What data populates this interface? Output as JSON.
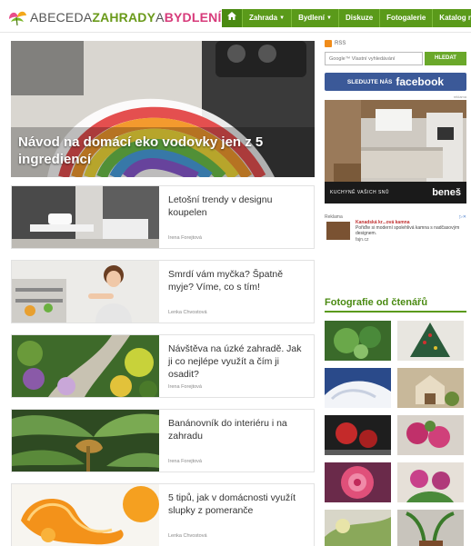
{
  "logo": {
    "part1": "ABECEDA",
    "part2": "ZAHRADY",
    "part3": "A",
    "part4": "BYDLENÍ"
  },
  "nav": {
    "items": [
      {
        "label": "Zahrada",
        "dropdown": true
      },
      {
        "label": "Bydlení",
        "dropdown": true
      },
      {
        "label": "Diskuze",
        "dropdown": false
      },
      {
        "label": "Fotogalerie",
        "dropdown": false
      },
      {
        "label": "Katalog rostlin",
        "dropdown": false
      }
    ]
  },
  "hero": {
    "title": "Návod na domácí eko vodovky jen z 5 ingrediencí"
  },
  "articles": [
    {
      "title": "Letošní trendy v designu koupelen",
      "author": "Irena Forejtová"
    },
    {
      "title": "Smrdí vám myčka? Špatně myje? Víme, co s tím!",
      "author": "Lenka Chvostová"
    },
    {
      "title": "Návštěva na úzké zahradě. Jak ji co nejlépe využít a čím ji osadit?",
      "author": "Irena Forejtová"
    },
    {
      "title": "Banánovník do interiéru i na zahradu",
      "author": "Irena Forejtová"
    },
    {
      "title": "5 tipů, jak v domácnosti využít slupky z pomeranče",
      "author": "Lenka Chvostová"
    }
  ],
  "sidebar": {
    "rss_label": "RSS",
    "search_placeholder": "Google™ Vlastní vyhledávání",
    "search_button": "HLEDAT",
    "fb_small": "SLEDUJTE NÁS",
    "fb_big": "facebook",
    "ad_tag": "reklama",
    "ad_slogan": "KUCHYNĚ VAŠICH SNŮ",
    "ad_brand": "beneš",
    "reklama_label": "Reklama",
    "reklama_title": "Kanadská kr...ová kamna",
    "reklama_desc": "Pořiďte si moderní spolehlivá kamna s nadčasovým designem.",
    "reklama_url": "fajn.cz",
    "photos_title": "Fotografie od čtenářů"
  },
  "colors": {
    "accent_green": "#5a9a1a",
    "brand_pink": "#d73a7a",
    "facebook_blue": "#3b5998"
  }
}
